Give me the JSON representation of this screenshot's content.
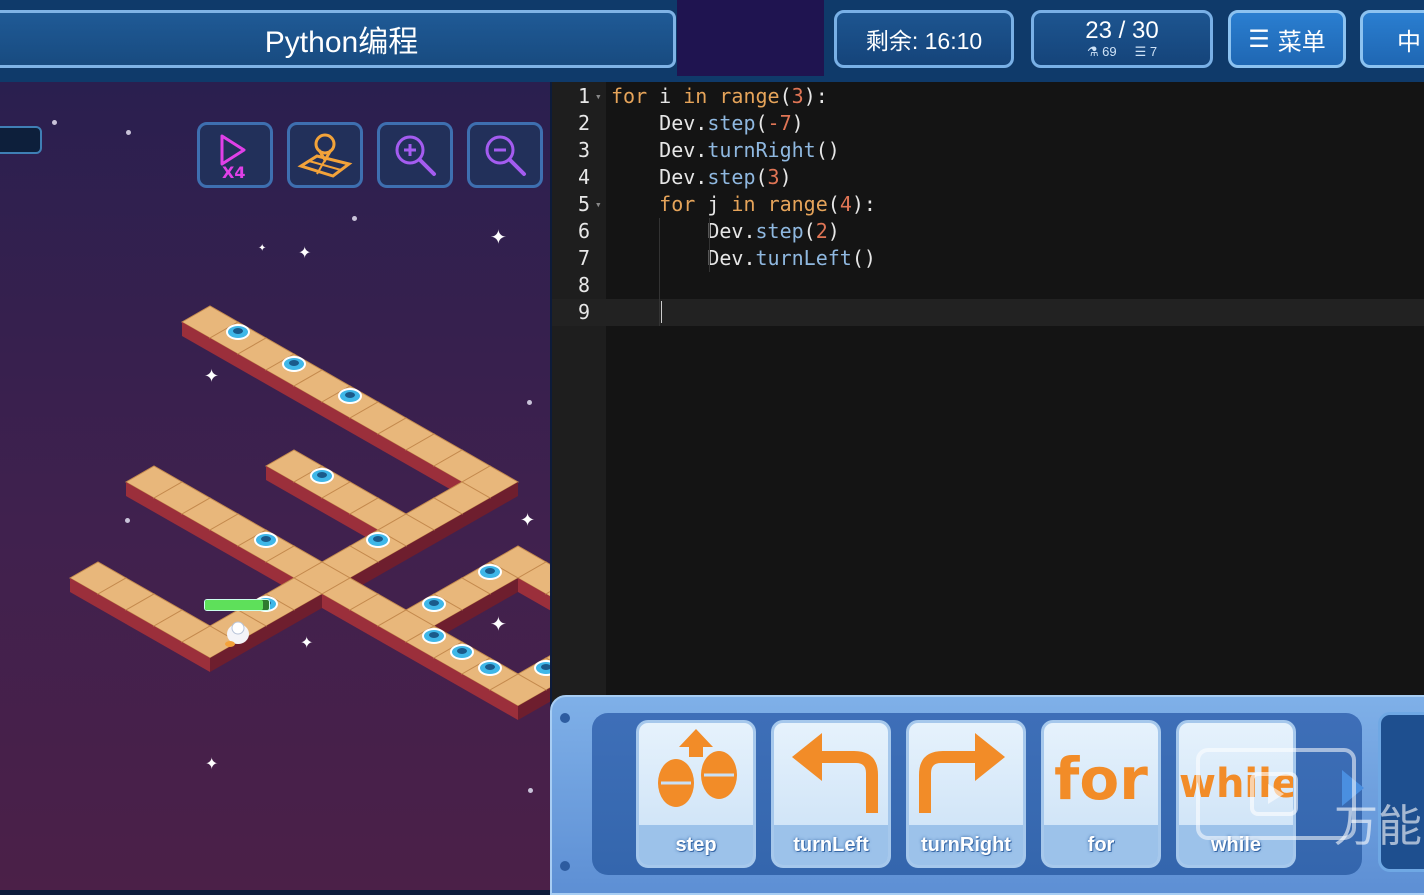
{
  "header": {
    "title": "Python编程",
    "timer": "剩余: 16:10",
    "score": "23 / 30",
    "stat_a": "69",
    "stat_b": "7",
    "menu_label": "菜单",
    "lang_label": "中"
  },
  "game": {
    "speed_label": "X4",
    "health_fraction": 0.9
  },
  "editor": {
    "lines": [
      {
        "n": "1",
        "tokens": [
          [
            "kw",
            "for"
          ],
          [
            "t",
            " i "
          ],
          [
            "kw",
            "in"
          ],
          [
            "t",
            " "
          ],
          [
            "kw",
            "range"
          ],
          [
            "t",
            "("
          ],
          [
            "numlit",
            "3"
          ],
          [
            "t",
            "):"
          ]
        ]
      },
      {
        "n": "2",
        "tokens": [
          [
            "t",
            "    Dev."
          ],
          [
            "fn",
            "step"
          ],
          [
            "t",
            "("
          ],
          [
            "numlit",
            "-7"
          ],
          [
            "t",
            ")"
          ]
        ]
      },
      {
        "n": "3",
        "tokens": [
          [
            "t",
            "    Dev."
          ],
          [
            "fn",
            "turnRight"
          ],
          [
            "t",
            "()"
          ]
        ]
      },
      {
        "n": "4",
        "tokens": [
          [
            "t",
            "    Dev."
          ],
          [
            "fn",
            "step"
          ],
          [
            "t",
            "("
          ],
          [
            "numlit",
            "3"
          ],
          [
            "t",
            ")"
          ]
        ]
      },
      {
        "n": "5",
        "tokens": [
          [
            "t",
            "    "
          ],
          [
            "kw",
            "for"
          ],
          [
            "t",
            " j "
          ],
          [
            "kw",
            "in"
          ],
          [
            "t",
            " "
          ],
          [
            "kw",
            "range"
          ],
          [
            "t",
            "("
          ],
          [
            "numlit",
            "4"
          ],
          [
            "t",
            "):"
          ]
        ]
      },
      {
        "n": "6",
        "tokens": [
          [
            "t",
            "        Dev."
          ],
          [
            "fn",
            "step"
          ],
          [
            "t",
            "("
          ],
          [
            "numlit",
            "2"
          ],
          [
            "t",
            ")"
          ]
        ]
      },
      {
        "n": "7",
        "tokens": [
          [
            "t",
            "        Dev."
          ],
          [
            "fn",
            "turnLeft"
          ],
          [
            "t",
            "()"
          ]
        ]
      },
      {
        "n": "8",
        "tokens": []
      },
      {
        "n": "9",
        "tokens": []
      }
    ],
    "active_line": 9
  },
  "palette": {
    "blocks": [
      {
        "label": "step",
        "art": "step"
      },
      {
        "label": "turnLeft",
        "art": "turnLeft"
      },
      {
        "label": "turnRight",
        "art": "turnRight"
      },
      {
        "label": "for",
        "art": "for"
      },
      {
        "label": "while",
        "art": "while"
      }
    ]
  },
  "watermark": {
    "text": "万能"
  },
  "colors": {
    "accent": "#1f67b3",
    "keyword": "#e6a45a",
    "function": "#8fb8e0",
    "number": "#e07555",
    "block_orange": "#f28c28"
  }
}
